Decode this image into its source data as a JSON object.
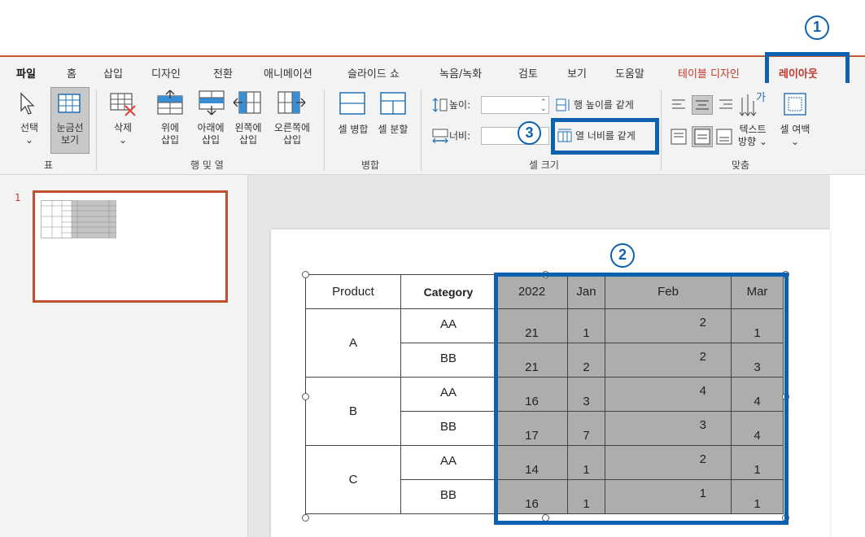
{
  "tabs": {
    "file": "파일",
    "home": "홈",
    "insert": "삽입",
    "design": "디자인",
    "transitions": "전환",
    "animations": "애니메이션",
    "slideshow": "슬라이드 쇼",
    "record": "녹음/녹화",
    "review": "검토",
    "view": "보기",
    "help": "도움말",
    "table_design": "테이블 디자인",
    "layout": "레이아웃"
  },
  "ribbon": {
    "select": {
      "line1": "선택",
      "line2": "⌄"
    },
    "gridlines": {
      "line1": "눈금선",
      "line2": "보기"
    },
    "delete": {
      "line1": "삭제",
      "line2": "⌄"
    },
    "insert_above": {
      "line1": "위에",
      "line2": "삽입"
    },
    "insert_below": {
      "line1": "아래에",
      "line2": "삽입"
    },
    "insert_left": {
      "line1": "왼쪽에",
      "line2": "삽입"
    },
    "insert_right": {
      "line1": "오른쪽에",
      "line2": "삽입"
    },
    "merge_cells": "셀 병합",
    "split_cells": "셀 분할",
    "height_label": "높이:",
    "width_label": "너비:",
    "height_value": "",
    "width_value": "",
    "distribute_rows": "행 높이를 같게",
    "distribute_cols": "열 너비를 같게",
    "text_direction": {
      "line1": "텍스트",
      "line2": "방향 ⌄"
    },
    "cell_margins": {
      "line1": "셀 여백",
      "line2": "⌄"
    },
    "groups": {
      "table": "표",
      "rows_cols": "행 및 열",
      "merge": "병합",
      "cell_size": "셀 크기",
      "alignment": "맞춤"
    }
  },
  "slide_panel": {
    "slide_number": "1"
  },
  "table": {
    "headers": [
      "Product",
      "Category",
      "2022",
      "Jan",
      "Feb",
      "Mar"
    ],
    "rows": [
      {
        "product": "A",
        "category": "AA",
        "values": [
          "21",
          "1",
          "2",
          "1"
        ]
      },
      {
        "category": "BB",
        "values": [
          "21",
          "2",
          "2",
          "3"
        ]
      },
      {
        "product": "B",
        "category": "AA",
        "values": [
          "16",
          "3",
          "4",
          "4"
        ]
      },
      {
        "category": "BB",
        "values": [
          "17",
          "7",
          "3",
          "4"
        ]
      },
      {
        "product": "C",
        "category": "AA",
        "values": [
          "14",
          "1",
          "2",
          "1"
        ]
      },
      {
        "category": "BB",
        "values": [
          "16",
          "1",
          "1",
          "1"
        ]
      }
    ]
  },
  "callouts": {
    "one": "1",
    "two": "2",
    "three": "3"
  },
  "colors": {
    "accent_red": "#c0392b",
    "callout_blue": "#0d62b0",
    "selected_cells": "#adadad"
  }
}
